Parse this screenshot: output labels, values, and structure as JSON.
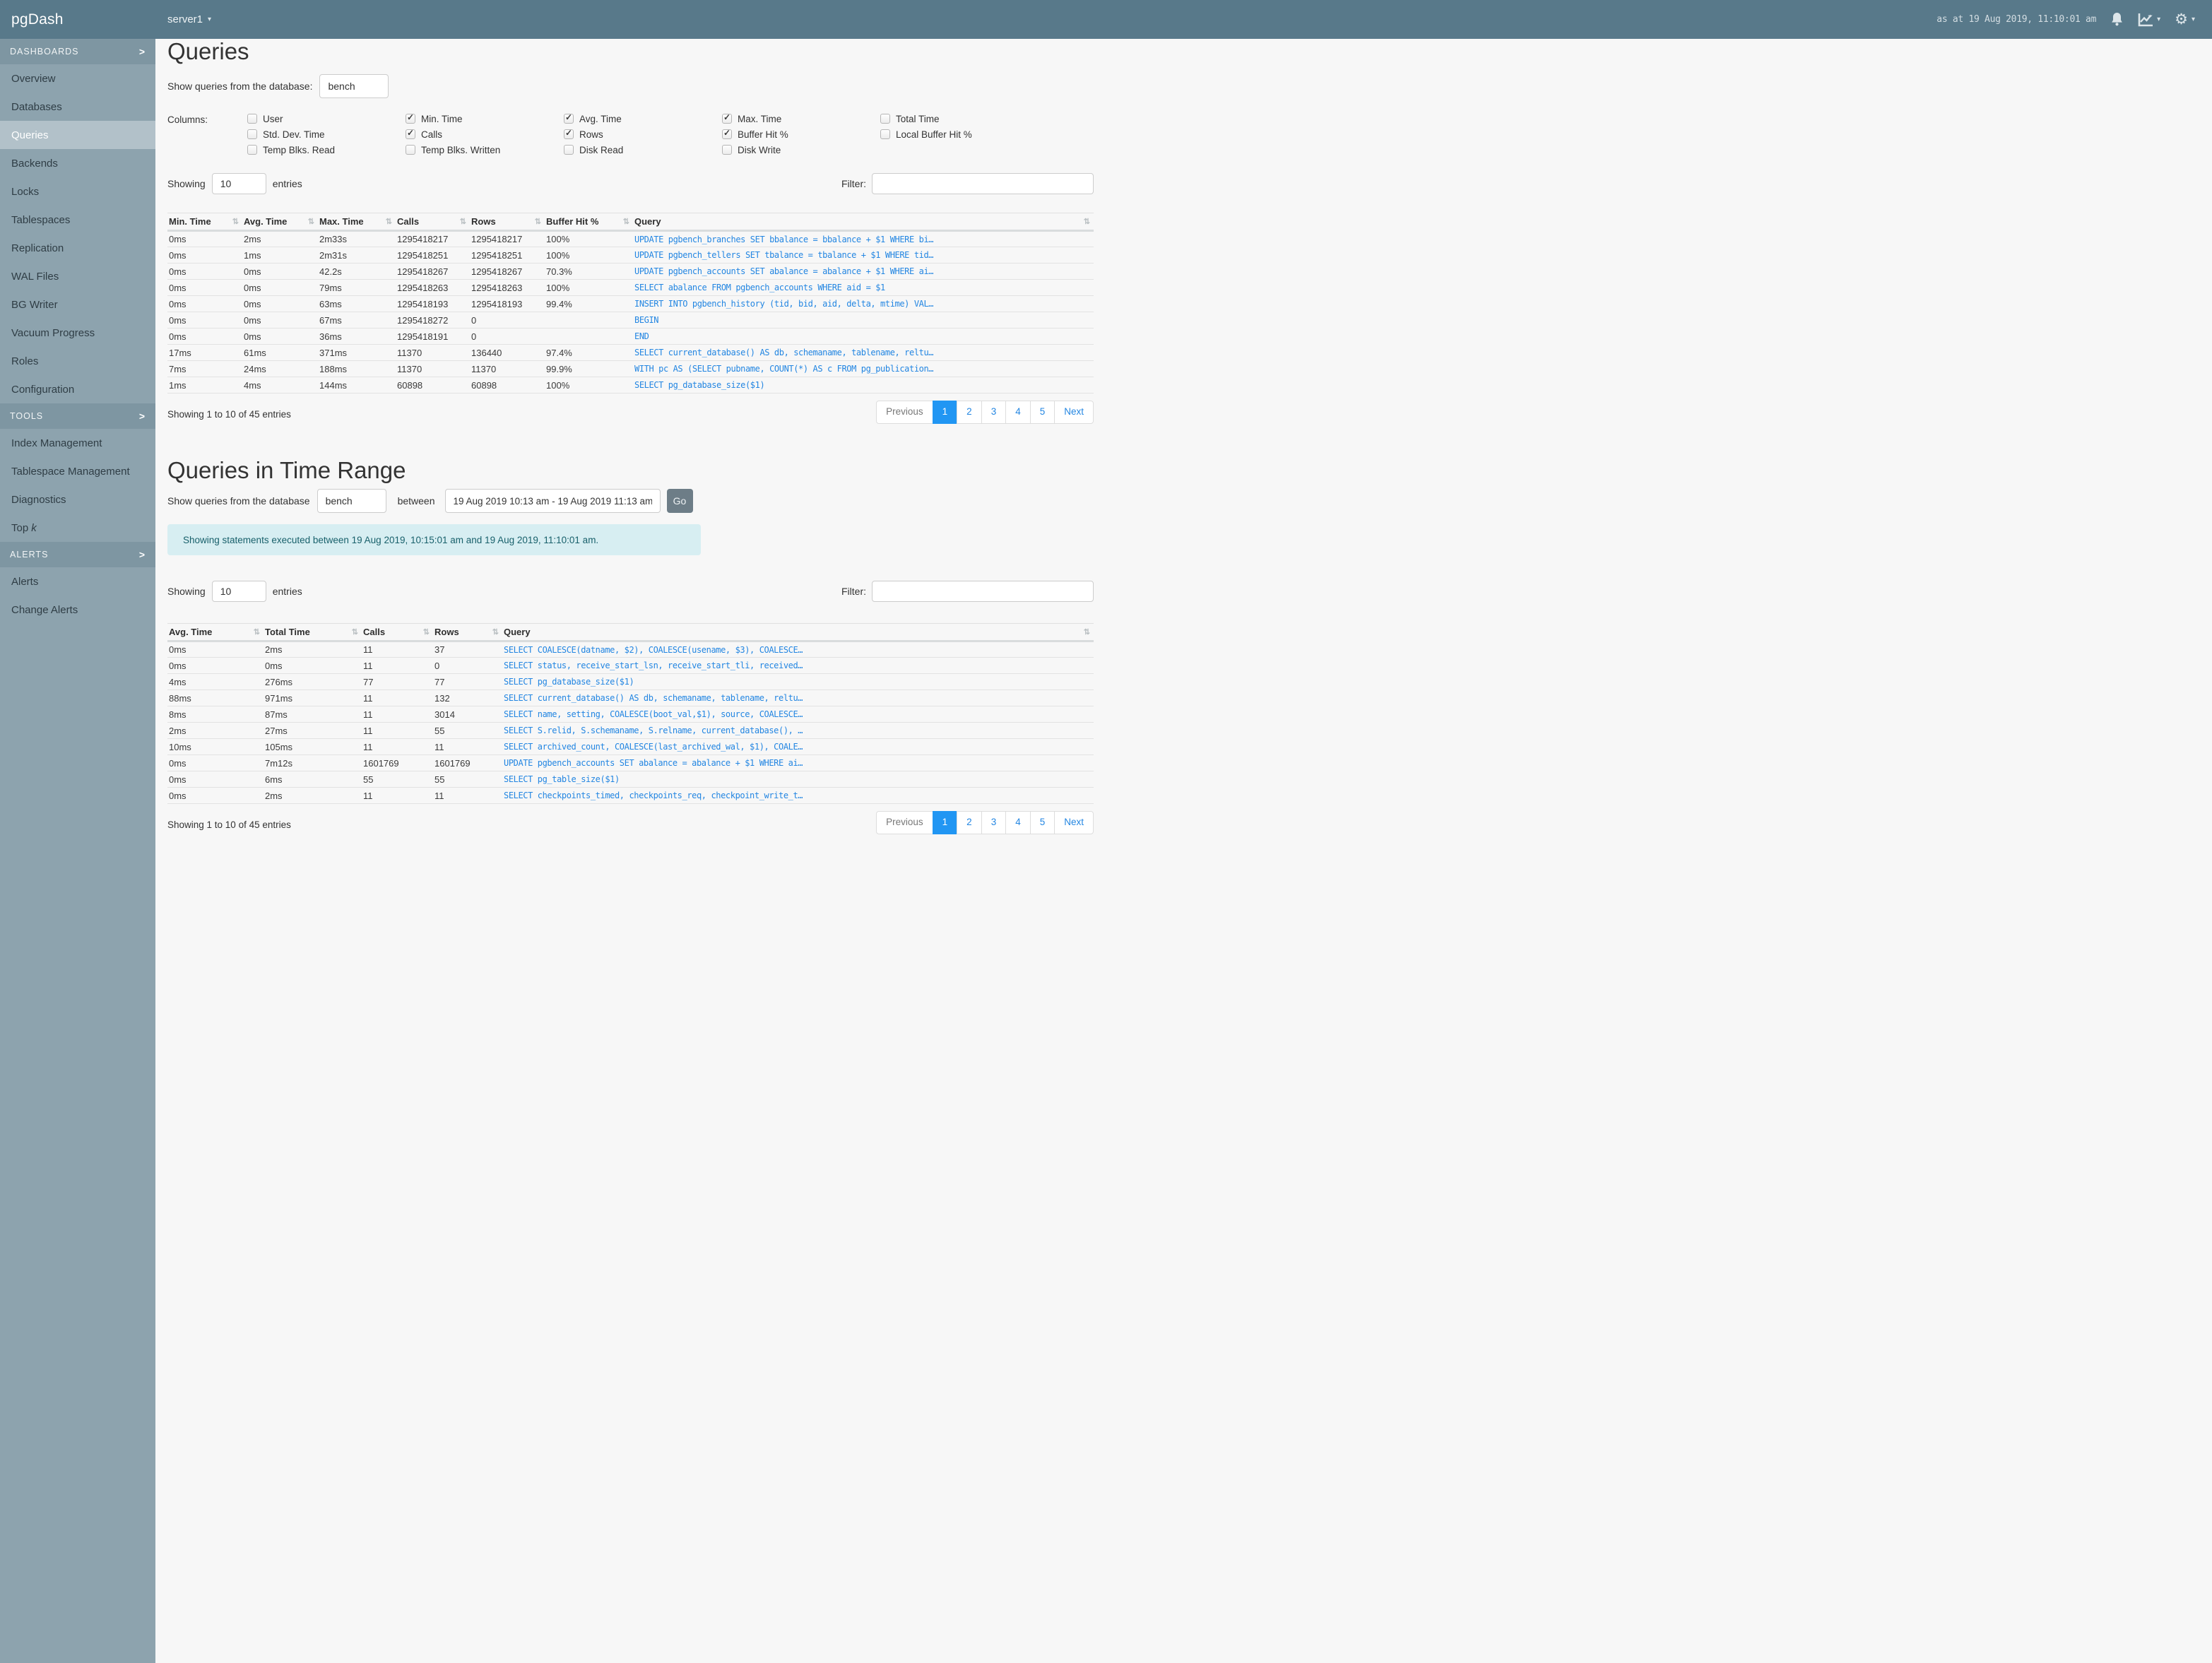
{
  "icons": {
    "chevron_right": ">",
    "caret_down": "▾",
    "sort": "⇅",
    "check": "✓",
    "gear": "⚙"
  },
  "topbar": {
    "brand": "pgDash",
    "server": "server1",
    "timestamp": "as at 19 Aug 2019, 11:10:01 am"
  },
  "sidebar": {
    "active_item": "Queries",
    "sections": [
      {
        "label": "DASHBOARDS",
        "items": [
          {
            "label": "Overview"
          },
          {
            "label": "Databases"
          },
          {
            "label": "Queries"
          },
          {
            "label": "Backends"
          },
          {
            "label": "Locks"
          },
          {
            "label": "Tablespaces"
          },
          {
            "label": "Replication"
          },
          {
            "label": "WAL Files"
          },
          {
            "label": "BG Writer"
          },
          {
            "label": "Vacuum Progress"
          },
          {
            "label": "Roles"
          },
          {
            "label": "Configuration"
          }
        ]
      },
      {
        "label": "TOOLS",
        "items": [
          {
            "label": "Index Management"
          },
          {
            "label": "Tablespace Management"
          },
          {
            "label": "Diagnostics"
          },
          {
            "label": "Top ",
            "suffix_italic": "k"
          }
        ]
      },
      {
        "label": "ALERTS",
        "items": [
          {
            "label": "Alerts"
          },
          {
            "label": "Change Alerts"
          }
        ]
      }
    ]
  },
  "queries_section": {
    "title": "Queries",
    "db_label": "Show queries from the database:",
    "db_value": "bench",
    "columns_label": "Columns:",
    "checkbox_columns": [
      [
        {
          "label": "User",
          "checked": false
        },
        {
          "label": "Std. Dev. Time",
          "checked": false
        },
        {
          "label": "Temp Blks. Read",
          "checked": false
        }
      ],
      [
        {
          "label": "Min. Time",
          "checked": true
        },
        {
          "label": "Calls",
          "checked": true
        },
        {
          "label": "Temp Blks. Written",
          "checked": false
        }
      ],
      [
        {
          "label": "Avg. Time",
          "checked": true
        },
        {
          "label": "Rows",
          "checked": true
        },
        {
          "label": "Disk Read",
          "checked": false
        }
      ],
      [
        {
          "label": "Max. Time",
          "checked": true
        },
        {
          "label": "Buffer Hit %",
          "checked": true
        },
        {
          "label": "Disk Write",
          "checked": false
        }
      ],
      [
        {
          "label": "Total Time",
          "checked": false
        },
        {
          "label": "Local Buffer Hit %",
          "checked": false
        }
      ]
    ],
    "showing_label": "Showing",
    "page_size": "10",
    "entries_label": "entries",
    "filter_label": "Filter:",
    "filter_value": "",
    "table": {
      "columns": [
        "Min. Time",
        "Avg. Time",
        "Max. Time",
        "Calls",
        "Rows",
        "Buffer Hit %",
        "Query"
      ],
      "rows": [
        [
          "0ms",
          "2ms",
          "2m33s",
          "1295418217",
          "1295418217",
          "100%",
          "UPDATE pgbench_branches SET bbalance = bbalance + $1 WHERE bi…"
        ],
        [
          "0ms",
          "1ms",
          "2m31s",
          "1295418251",
          "1295418251",
          "100%",
          "UPDATE pgbench_tellers SET tbalance = tbalance + $1 WHERE tid…"
        ],
        [
          "0ms",
          "0ms",
          "42.2s",
          "1295418267",
          "1295418267",
          "70.3%",
          "UPDATE pgbench_accounts SET abalance = abalance + $1 WHERE ai…"
        ],
        [
          "0ms",
          "0ms",
          "79ms",
          "1295418263",
          "1295418263",
          "100%",
          "SELECT abalance FROM pgbench_accounts WHERE aid = $1"
        ],
        [
          "0ms",
          "0ms",
          "63ms",
          "1295418193",
          "1295418193",
          "99.4%",
          "INSERT INTO pgbench_history (tid, bid, aid, delta, mtime) VAL…"
        ],
        [
          "0ms",
          "0ms",
          "67ms",
          "1295418272",
          "0",
          "",
          "BEGIN"
        ],
        [
          "0ms",
          "0ms",
          "36ms",
          "1295418191",
          "0",
          "",
          "END"
        ],
        [
          "17ms",
          "61ms",
          "371ms",
          "11370",
          "136440",
          "97.4%",
          "SELECT current_database() AS db, schemaname, tablename, reltu…"
        ],
        [
          "7ms",
          "24ms",
          "188ms",
          "11370",
          "11370",
          "99.9%",
          "WITH pc AS (SELECT pubname, COUNT(*) AS c FROM pg_publication…"
        ],
        [
          "1ms",
          "4ms",
          "144ms",
          "60898",
          "60898",
          "100%",
          "SELECT pg_database_size($1)"
        ]
      ]
    },
    "footer": "Showing 1 to 10 of 45 entries",
    "pagination": {
      "prev": "Previous",
      "pages": [
        "1",
        "2",
        "3",
        "4",
        "5"
      ],
      "active": "1",
      "next": "Next"
    }
  },
  "time_range_section": {
    "title": "Queries in Time Range",
    "db_label": "Show queries from the database",
    "db_value": "bench",
    "between_label": "between",
    "range_value": "19 Aug 2019 10:13 am - 19 Aug 2019 11:13 am",
    "go_label": "Go",
    "banner": "Showing statements executed between 19 Aug 2019, 10:15:01 am and 19 Aug 2019, 11:10:01 am.",
    "showing_label": "Showing",
    "page_size": "10",
    "entries_label": "entries",
    "filter_label": "Filter:",
    "filter_value": "",
    "table": {
      "columns": [
        "Avg. Time",
        "Total Time",
        "Calls",
        "Rows",
        "Query"
      ],
      "rows": [
        [
          "0ms",
          "2ms",
          "11",
          "37",
          "SELECT COALESCE(datname, $2), COALESCE(usename, $3), COALESCE…"
        ],
        [
          "0ms",
          "0ms",
          "11",
          "0",
          "SELECT status, receive_start_lsn, receive_start_tli, received…"
        ],
        [
          "4ms",
          "276ms",
          "77",
          "77",
          "SELECT pg_database_size($1)"
        ],
        [
          "88ms",
          "971ms",
          "11",
          "132",
          "SELECT current_database() AS db, schemaname, tablename, reltu…"
        ],
        [
          "8ms",
          "87ms",
          "11",
          "3014",
          "SELECT name, setting, COALESCE(boot_val,$1), source, COALESCE…"
        ],
        [
          "2ms",
          "27ms",
          "11",
          "55",
          "SELECT S.relid, S.schemaname, S.relname, current_database(), …"
        ],
        [
          "10ms",
          "105ms",
          "11",
          "11",
          "SELECT archived_count, COALESCE(last_archived_wal, $1), COALE…"
        ],
        [
          "0ms",
          "7m12s",
          "1601769",
          "1601769",
          "UPDATE pgbench_accounts SET abalance = abalance + $1 WHERE ai…"
        ],
        [
          "0ms",
          "6ms",
          "55",
          "55",
          "SELECT pg_table_size($1)"
        ],
        [
          "0ms",
          "2ms",
          "11",
          "11",
          "SELECT checkpoints_timed, checkpoints_req, checkpoint_write_t…"
        ]
      ]
    },
    "footer": "Showing 1 to 10 of 45 entries",
    "pagination": {
      "prev": "Previous",
      "pages": [
        "1",
        "2",
        "3",
        "4",
        "5"
      ],
      "active": "1",
      "next": "Next"
    }
  },
  "colors": {
    "topbar": "#58798a",
    "sidebar": "#8da3ae",
    "section_header": "#7e96a2",
    "active_item": "#b2c1c9",
    "link_blue": "#2386e2",
    "pagination_active": "#2196f3",
    "banner_bg": "#d7eef2",
    "banner_text": "#18606b"
  }
}
